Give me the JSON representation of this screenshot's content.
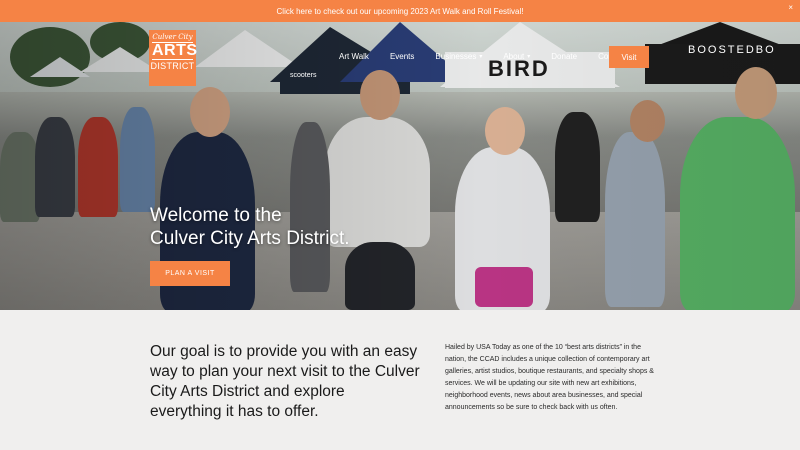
{
  "announcement": {
    "text": "Click here to check out our upcoming 2023 Art Walk and Roll Festival!",
    "close": "×"
  },
  "logo": {
    "top": "Culver City",
    "mid": "ARTS",
    "bottom": "DISTRICT"
  },
  "nav": {
    "items": [
      {
        "label": "Art Walk",
        "caret": ""
      },
      {
        "label": "Events",
        "caret": ""
      },
      {
        "label": "Businesses",
        "caret": "▾"
      },
      {
        "label": "About",
        "caret": "▾"
      },
      {
        "label": "Donate",
        "caret": ""
      },
      {
        "label": "Contact",
        "caret": ""
      }
    ],
    "visit_label": "Visit"
  },
  "hero": {
    "title_line1": "Welcome to the",
    "title_line2": "Culver City Arts District.",
    "cta_label": "PLAN A VISIT",
    "tent_sign_1": "BIRD",
    "tent_sign_2": "BOOSTEDBO",
    "tent_sign_3": "scooters"
  },
  "intro": {
    "goal": "Our goal is to provide you with an easy way to plan your next visit to the Culver City Arts District and explore everything it has to offer.",
    "description": "Hailed by USA Today as one of the 10 “best arts districts” in the nation, the CCAD includes a unique collection of contemporary art galleries, artist studios, boutique restaurants, and specialty shops & services. We will be updating our site with new art exhibitions, neighborhood events, news about area businesses, and special announcements so be sure to check back with us often."
  },
  "colors": {
    "accent": "#f58345",
    "background": "#f0efee",
    "text": "#1a1a1a"
  }
}
